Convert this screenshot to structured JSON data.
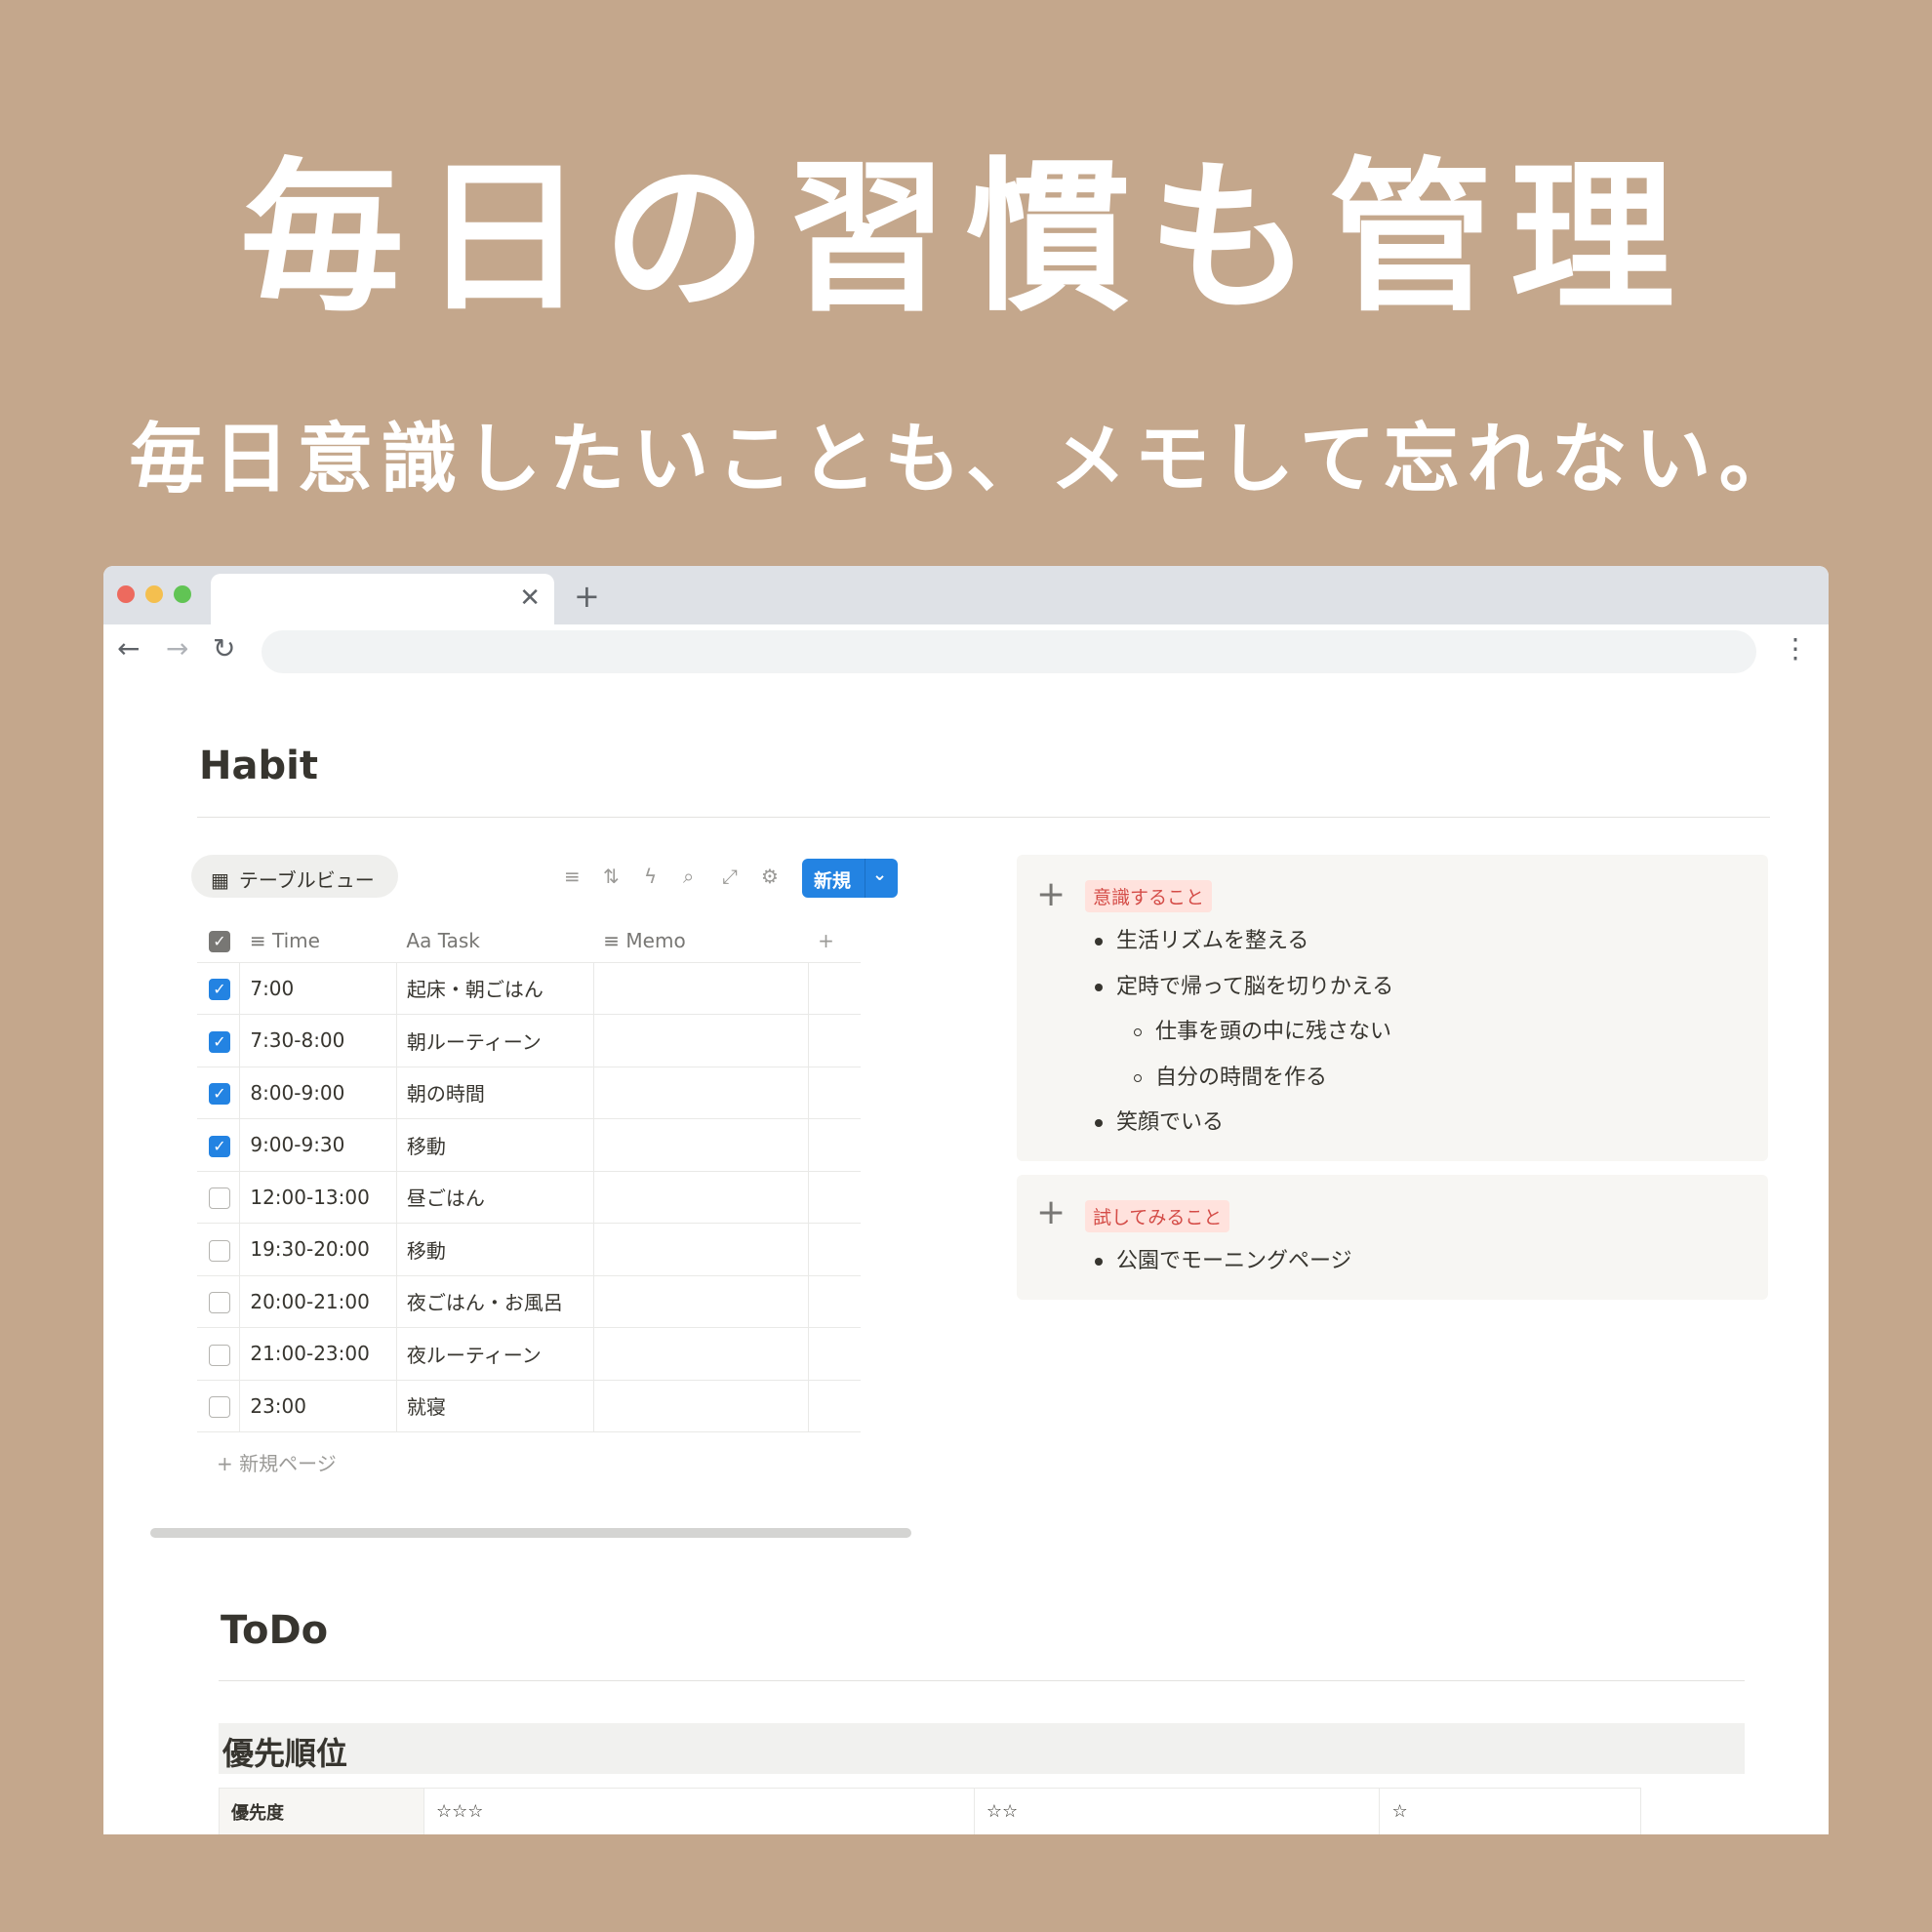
{
  "hero": {
    "headline": "毎日の習慣も管理",
    "subline": "毎日意識したいことも、メモして忘れない。"
  },
  "browser": {
    "tab_close": "✕",
    "tab_new": "+",
    "back": "←",
    "forward": "→",
    "reload": "↻",
    "menu": "⋮"
  },
  "habit": {
    "title": "Habit",
    "view_label": "テーブルビュー",
    "new_button": "新規",
    "columns": {
      "time": "Time",
      "task": "Task",
      "memo": "Memo"
    },
    "rows": [
      {
        "checked": true,
        "time": "7:00",
        "task": "起床・朝ごはん"
      },
      {
        "checked": true,
        "time": "7:30-8:00",
        "task": "朝ルーティーン"
      },
      {
        "checked": true,
        "time": "8:00-9:00",
        "task": "朝の時間"
      },
      {
        "checked": true,
        "time": "9:00-9:30",
        "task": "移動"
      },
      {
        "checked": false,
        "time": "12:00-13:00",
        "task": "昼ごはん"
      },
      {
        "checked": false,
        "time": "19:30-20:00",
        "task": "移動"
      },
      {
        "checked": false,
        "time": "20:00-21:00",
        "task": "夜ごはん・お風呂"
      },
      {
        "checked": false,
        "time": "21:00-23:00",
        "task": "夜ルーティーン"
      },
      {
        "checked": false,
        "time": "23:00",
        "task": "就寝"
      }
    ],
    "new_page": "新規ページ"
  },
  "callouts": {
    "mindful": {
      "tag": "意識すること",
      "items": [
        "生活リズムを整える",
        "定時で帰って脳を切りかえる",
        "仕事を頭の中に残さない",
        "自分の時間を作る",
        "笑顔でいる"
      ]
    },
    "try": {
      "tag": "試してみること",
      "items": [
        "公園でモーニングページ"
      ]
    }
  },
  "todo": {
    "title": "ToDo",
    "priority_heading": "優先順位",
    "priority_label": "優先度",
    "priority_levels": [
      "☆☆☆",
      "☆☆",
      "☆"
    ]
  }
}
